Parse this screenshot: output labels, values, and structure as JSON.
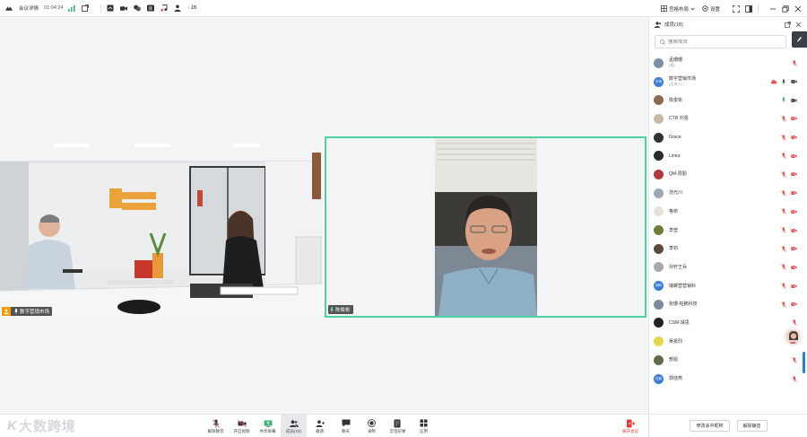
{
  "topbar": {
    "title": "会议详情",
    "timer": "01:04:24",
    "participant_count": "16",
    "layout_label": "宫格布局",
    "settings_label": "设置"
  },
  "stage": {
    "left_tile_name": "数字营销市场",
    "right_tile_name": "陈俊彬"
  },
  "logo": {
    "text": "大数跨境",
    "mark": "K"
  },
  "toolbar": {
    "tools": [
      {
        "label": "解除静音",
        "icon": "mic-muted-icon"
      },
      {
        "label": "开启视频",
        "icon": "camera-off-icon"
      },
      {
        "label": "共享屏幕",
        "icon": "share-screen-icon"
      },
      {
        "label": "成员(18)",
        "icon": "members-icon"
      },
      {
        "label": "邀请",
        "icon": "invite-icon"
      },
      {
        "label": "聊天",
        "icon": "chat-icon"
      },
      {
        "label": "录制",
        "icon": "record-icon"
      },
      {
        "label": "云签纪要",
        "icon": "notes-icon"
      },
      {
        "label": "应用",
        "icon": "apps-icon"
      }
    ],
    "leave_label": "离开会议"
  },
  "panel": {
    "title": "成员(18)",
    "search_placeholder": "搜索成员",
    "members": [
      {
        "name": "孟珊珊",
        "sub": "(我)",
        "avatar_color": "#7b8fa3",
        "avatar_text": ""
      },
      {
        "name": "数字营销市场",
        "sub": "(主持人)",
        "avatar_color": "#3a7bd5",
        "avatar_text": "市场"
      },
      {
        "name": "陈俊彬",
        "sub": "",
        "avatar_color": "#8a6b55",
        "avatar_text": ""
      },
      {
        "name": "CTR 刘强",
        "sub": "",
        "avatar_color": "#c9b8a4",
        "avatar_text": ""
      },
      {
        "name": "Grace",
        "sub": "",
        "avatar_color": "#333333",
        "avatar_text": ""
      },
      {
        "name": "Linna",
        "sub": "",
        "avatar_color": "#2b2b2b",
        "avatar_text": ""
      },
      {
        "name": "QM-周勤",
        "sub": "",
        "avatar_color": "#b23a3a",
        "avatar_text": ""
      },
      {
        "name": "范光川",
        "sub": "",
        "avatar_color": "#9aa7b4",
        "avatar_text": ""
      },
      {
        "name": "格桥",
        "sub": "",
        "avatar_color": "#e6e1d8",
        "avatar_text": ""
      },
      {
        "name": "李莹",
        "sub": "",
        "avatar_color": "#6b7d3a",
        "avatar_text": ""
      },
      {
        "name": "李钧",
        "sub": "",
        "avatar_color": "#5a4a3a",
        "avatar_text": ""
      },
      {
        "name": "孙轩王兵",
        "sub": "",
        "avatar_color": "#a5a9ad",
        "avatar_text": ""
      },
      {
        "name": "瑞螺营营销科",
        "sub": "",
        "avatar_color": "#3a7bd5",
        "avatar_text": "销科"
      },
      {
        "name": "张珊-帕鹏科技",
        "sub": "",
        "avatar_color": "#7a8a99",
        "avatar_text": ""
      },
      {
        "name": "CSM·靖思",
        "sub": "",
        "avatar_color": "#222222",
        "avatar_text": ""
      },
      {
        "name": "吴晏烈",
        "sub": "",
        "avatar_color": "#e5d64a",
        "avatar_text": ""
      },
      {
        "name": "敖姐",
        "sub": "",
        "avatar_color": "#5e6e4a",
        "avatar_text": ""
      },
      {
        "name": "郭佳燕",
        "sub": "",
        "avatar_color": "#3a7bd5",
        "avatar_text": "佳燕"
      }
    ],
    "modify_name_label": "修改会中昵称",
    "unmute_all_label": "解除静音"
  },
  "colors": {
    "accent": "#2d7be5",
    "speaker_border": "#4fd1a5",
    "muted_red": "#e05a5a",
    "unmuted_green": "#3ab27a",
    "leave_red": "#e53935"
  }
}
